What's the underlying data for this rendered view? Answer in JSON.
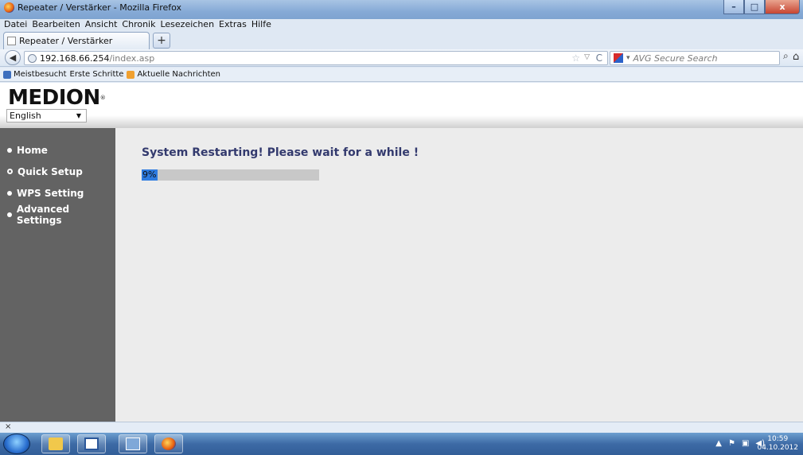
{
  "window": {
    "title": "Repeater / Verstärker - Mozilla Firefox",
    "minimize_label": "–",
    "maximize_label": "□",
    "close_label": "x"
  },
  "menubar": {
    "items": [
      "Datei",
      "Bearbeiten",
      "Ansicht",
      "Chronik",
      "Lesezeichen",
      "Extras",
      "Hilfe"
    ]
  },
  "tabs": {
    "active_tab_label": "Repeater / Verstärker",
    "new_tab_label": "+"
  },
  "navbar": {
    "url_host": "192.168.66.254",
    "url_path": "/index.asp",
    "search_placeholder": "AVG Secure Search"
  },
  "bookmarks": {
    "items": [
      "Meistbesucht",
      "Erste Schritte",
      "Aktuelle Nachrichten"
    ]
  },
  "page": {
    "logo_text": "MEDION",
    "logo_mark": "®",
    "language_selected": "English",
    "sidebar": {
      "items": [
        "Home",
        "Quick Setup",
        "WPS Setting",
        "Advanced Settings"
      ]
    },
    "message": "System Restarting! Please wait for a while !",
    "progress": {
      "percent": 9,
      "label": "9%"
    }
  },
  "findbar": {
    "close_label": "×"
  },
  "taskbar": {
    "clock_time": "10:59",
    "clock_date": "04.10.2012"
  },
  "colors": {
    "sidebar_bg": "#636363",
    "content_bg": "#ececec",
    "message_text": "#333a6e",
    "progress_fill": "#2e7be0",
    "progress_track": "#c8c8c8"
  }
}
